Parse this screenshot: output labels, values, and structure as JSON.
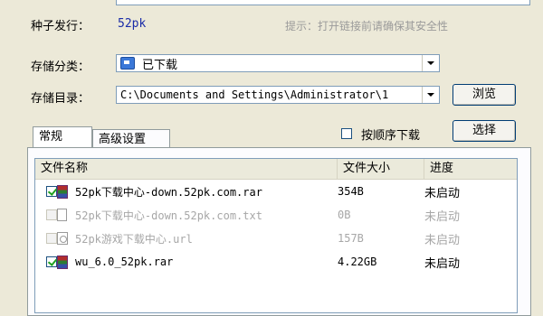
{
  "seed": {
    "label": "种子发行：",
    "value": "52pk",
    "hint": "提示：打开链接前请确保其安全性"
  },
  "category": {
    "label": "存储分类：",
    "value": "已下载"
  },
  "directory": {
    "label": "存储目录：",
    "value": "C:\\Documents and Settings\\Administrator\\1",
    "browse_label": "浏览"
  },
  "tabs": [
    {
      "label": "常规"
    },
    {
      "label": "高级设置"
    }
  ],
  "order_checkbox": {
    "label": "按顺序下载",
    "checked": false
  },
  "select_button": "选择",
  "file_list": {
    "columns": [
      "文件名称",
      "文件大小",
      "进度"
    ],
    "rows": [
      {
        "checked": true,
        "enabled": true,
        "icon": "rar-archive-icon",
        "name": "52pk下载中心-down.52pk.com.rar",
        "size": "354B",
        "progress": "未启动"
      },
      {
        "checked": false,
        "enabled": false,
        "icon": "text-file-icon",
        "name": "52pk下载中心-down.52pk.com.txt",
        "size": "0B",
        "progress": "未启动"
      },
      {
        "checked": false,
        "enabled": false,
        "icon": "url-shortcut-icon",
        "name": "52pk游戏下载中心.url",
        "size": "157B",
        "progress": "未启动"
      },
      {
        "checked": true,
        "enabled": true,
        "icon": "rar-archive-icon",
        "name": "wu_6.0_52pk.rar",
        "size": "4.22GB",
        "progress": "未启动"
      }
    ]
  }
}
